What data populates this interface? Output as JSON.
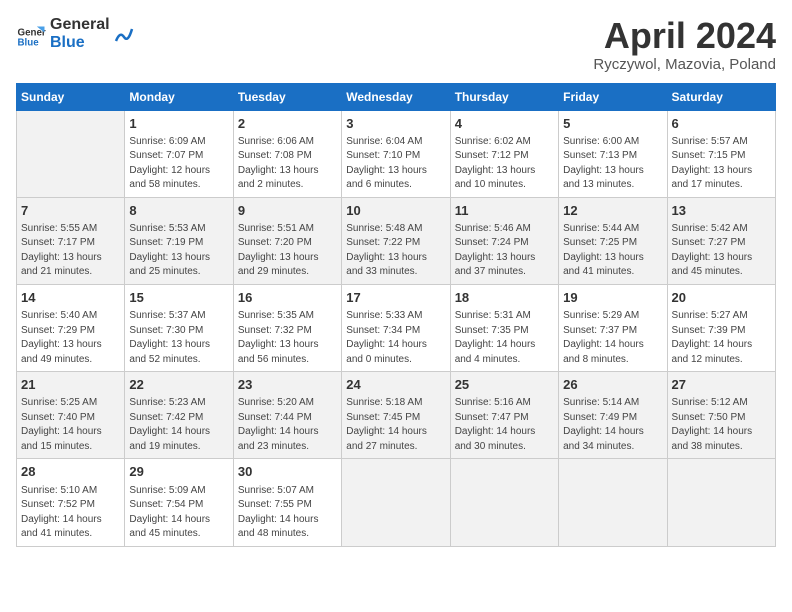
{
  "logo": {
    "line1": "General",
    "line2": "Blue"
  },
  "title": "April 2024",
  "location": "Ryczywol, Mazovia, Poland",
  "days_of_week": [
    "Sunday",
    "Monday",
    "Tuesday",
    "Wednesday",
    "Thursday",
    "Friday",
    "Saturday"
  ],
  "weeks": [
    [
      {
        "day": "",
        "info": ""
      },
      {
        "day": "1",
        "info": "Sunrise: 6:09 AM\nSunset: 7:07 PM\nDaylight: 12 hours\nand 58 minutes."
      },
      {
        "day": "2",
        "info": "Sunrise: 6:06 AM\nSunset: 7:08 PM\nDaylight: 13 hours\nand 2 minutes."
      },
      {
        "day": "3",
        "info": "Sunrise: 6:04 AM\nSunset: 7:10 PM\nDaylight: 13 hours\nand 6 minutes."
      },
      {
        "day": "4",
        "info": "Sunrise: 6:02 AM\nSunset: 7:12 PM\nDaylight: 13 hours\nand 10 minutes."
      },
      {
        "day": "5",
        "info": "Sunrise: 6:00 AM\nSunset: 7:13 PM\nDaylight: 13 hours\nand 13 minutes."
      },
      {
        "day": "6",
        "info": "Sunrise: 5:57 AM\nSunset: 7:15 PM\nDaylight: 13 hours\nand 17 minutes."
      }
    ],
    [
      {
        "day": "7",
        "info": "Sunrise: 5:55 AM\nSunset: 7:17 PM\nDaylight: 13 hours\nand 21 minutes."
      },
      {
        "day": "8",
        "info": "Sunrise: 5:53 AM\nSunset: 7:19 PM\nDaylight: 13 hours\nand 25 minutes."
      },
      {
        "day": "9",
        "info": "Sunrise: 5:51 AM\nSunset: 7:20 PM\nDaylight: 13 hours\nand 29 minutes."
      },
      {
        "day": "10",
        "info": "Sunrise: 5:48 AM\nSunset: 7:22 PM\nDaylight: 13 hours\nand 33 minutes."
      },
      {
        "day": "11",
        "info": "Sunrise: 5:46 AM\nSunset: 7:24 PM\nDaylight: 13 hours\nand 37 minutes."
      },
      {
        "day": "12",
        "info": "Sunrise: 5:44 AM\nSunset: 7:25 PM\nDaylight: 13 hours\nand 41 minutes."
      },
      {
        "day": "13",
        "info": "Sunrise: 5:42 AM\nSunset: 7:27 PM\nDaylight: 13 hours\nand 45 minutes."
      }
    ],
    [
      {
        "day": "14",
        "info": "Sunrise: 5:40 AM\nSunset: 7:29 PM\nDaylight: 13 hours\nand 49 minutes."
      },
      {
        "day": "15",
        "info": "Sunrise: 5:37 AM\nSunset: 7:30 PM\nDaylight: 13 hours\nand 52 minutes."
      },
      {
        "day": "16",
        "info": "Sunrise: 5:35 AM\nSunset: 7:32 PM\nDaylight: 13 hours\nand 56 minutes."
      },
      {
        "day": "17",
        "info": "Sunrise: 5:33 AM\nSunset: 7:34 PM\nDaylight: 14 hours\nand 0 minutes."
      },
      {
        "day": "18",
        "info": "Sunrise: 5:31 AM\nSunset: 7:35 PM\nDaylight: 14 hours\nand 4 minutes."
      },
      {
        "day": "19",
        "info": "Sunrise: 5:29 AM\nSunset: 7:37 PM\nDaylight: 14 hours\nand 8 minutes."
      },
      {
        "day": "20",
        "info": "Sunrise: 5:27 AM\nSunset: 7:39 PM\nDaylight: 14 hours\nand 12 minutes."
      }
    ],
    [
      {
        "day": "21",
        "info": "Sunrise: 5:25 AM\nSunset: 7:40 PM\nDaylight: 14 hours\nand 15 minutes."
      },
      {
        "day": "22",
        "info": "Sunrise: 5:23 AM\nSunset: 7:42 PM\nDaylight: 14 hours\nand 19 minutes."
      },
      {
        "day": "23",
        "info": "Sunrise: 5:20 AM\nSunset: 7:44 PM\nDaylight: 14 hours\nand 23 minutes."
      },
      {
        "day": "24",
        "info": "Sunrise: 5:18 AM\nSunset: 7:45 PM\nDaylight: 14 hours\nand 27 minutes."
      },
      {
        "day": "25",
        "info": "Sunrise: 5:16 AM\nSunset: 7:47 PM\nDaylight: 14 hours\nand 30 minutes."
      },
      {
        "day": "26",
        "info": "Sunrise: 5:14 AM\nSunset: 7:49 PM\nDaylight: 14 hours\nand 34 minutes."
      },
      {
        "day": "27",
        "info": "Sunrise: 5:12 AM\nSunset: 7:50 PM\nDaylight: 14 hours\nand 38 minutes."
      }
    ],
    [
      {
        "day": "28",
        "info": "Sunrise: 5:10 AM\nSunset: 7:52 PM\nDaylight: 14 hours\nand 41 minutes."
      },
      {
        "day": "29",
        "info": "Sunrise: 5:09 AM\nSunset: 7:54 PM\nDaylight: 14 hours\nand 45 minutes."
      },
      {
        "day": "30",
        "info": "Sunrise: 5:07 AM\nSunset: 7:55 PM\nDaylight: 14 hours\nand 48 minutes."
      },
      {
        "day": "",
        "info": ""
      },
      {
        "day": "",
        "info": ""
      },
      {
        "day": "",
        "info": ""
      },
      {
        "day": "",
        "info": ""
      }
    ]
  ]
}
